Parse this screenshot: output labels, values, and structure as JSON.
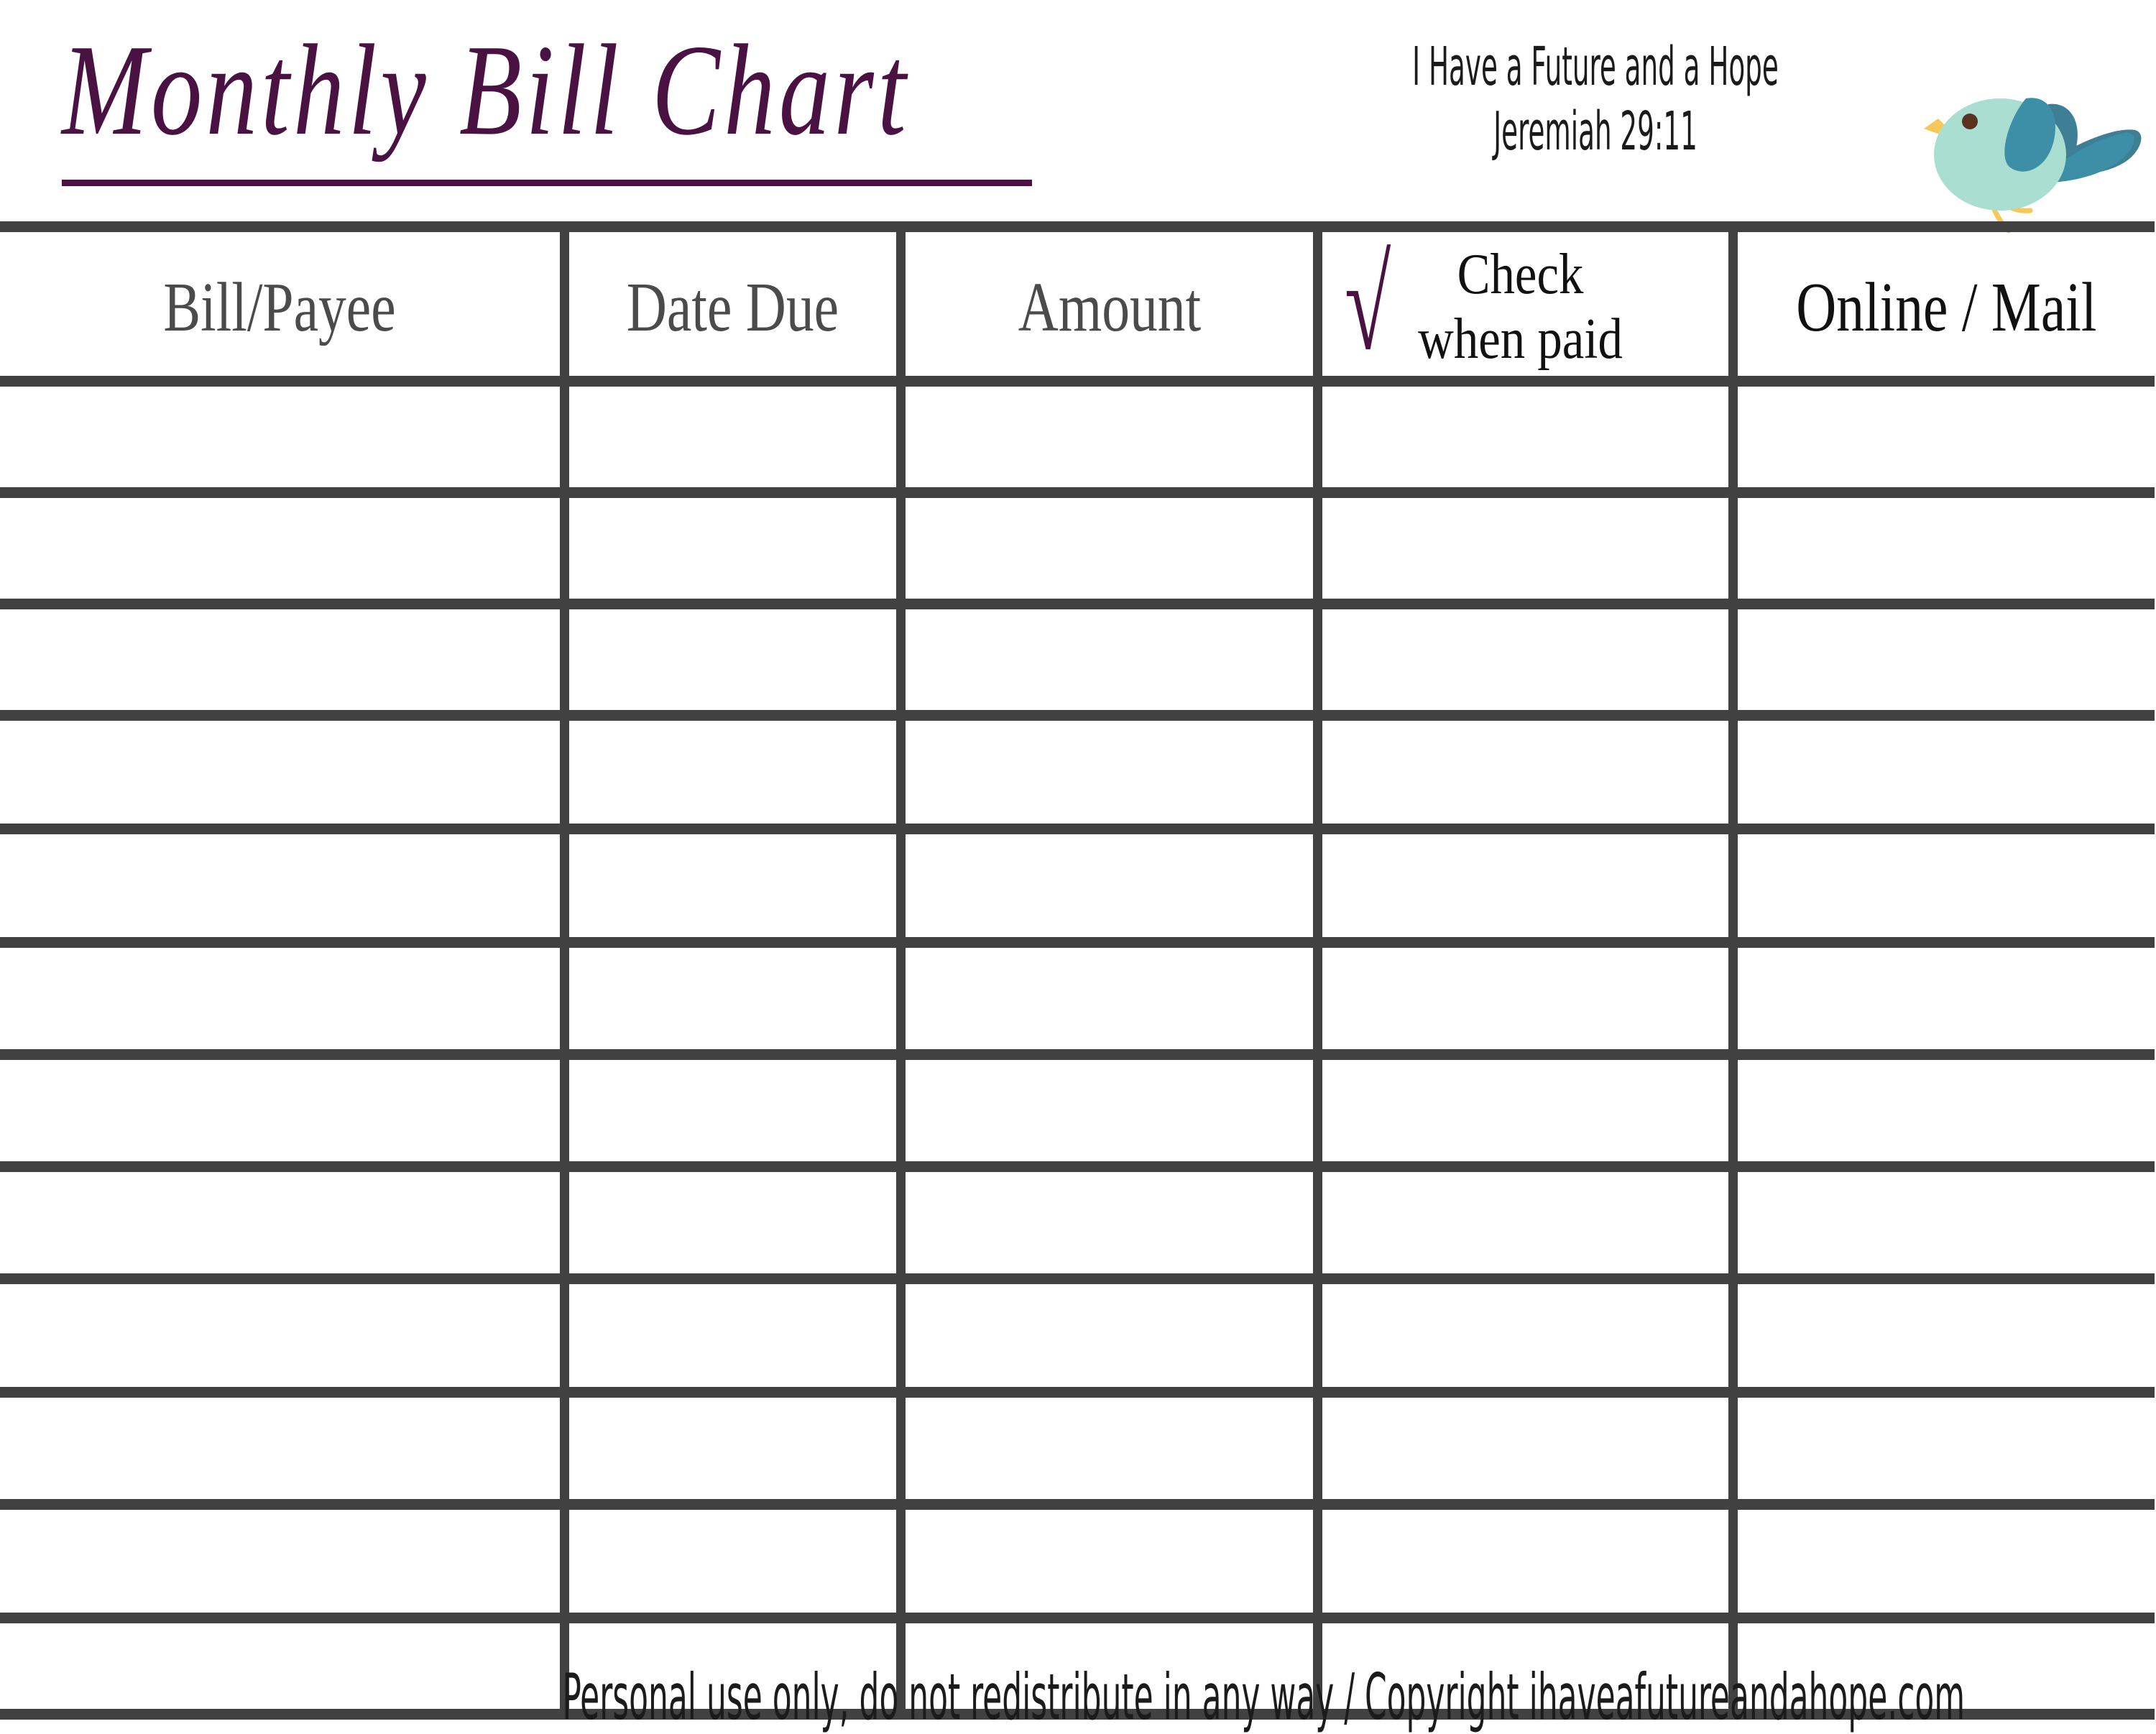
{
  "header": {
    "title": "Monthly Bill Chart",
    "title_color": "#4a1243",
    "tagline_line1": "I Have a Future and a Hope",
    "tagline_line2": "Jeremiah 29:11",
    "bird_icon": "bird-icon",
    "bird_colors": {
      "body": "#a9ded0",
      "wing_front": "#3d8fa8",
      "wing_back": "#3f7f96",
      "tail": "#3d8fa8",
      "beak": "#f6c85a",
      "legs": "#f6c85a",
      "eye": "#5a3220"
    }
  },
  "table": {
    "columns": [
      {
        "label": "Bill/Payee",
        "style": "gray"
      },
      {
        "label": "Date Due",
        "style": "gray"
      },
      {
        "label": "Amount",
        "style": "gray"
      },
      {
        "label": "Check when paid",
        "style": "check",
        "line1": "Check",
        "line2": "when paid",
        "check_glyph": "√",
        "check_color": "#4a1243"
      },
      {
        "label": "Online / Mail",
        "style": "black"
      }
    ],
    "row_count": 12,
    "grid_color": "#414141"
  },
  "footer": {
    "note": "Personal use only, do not redistribute in any way / Copyright ihaveafutureandahope.com"
  }
}
